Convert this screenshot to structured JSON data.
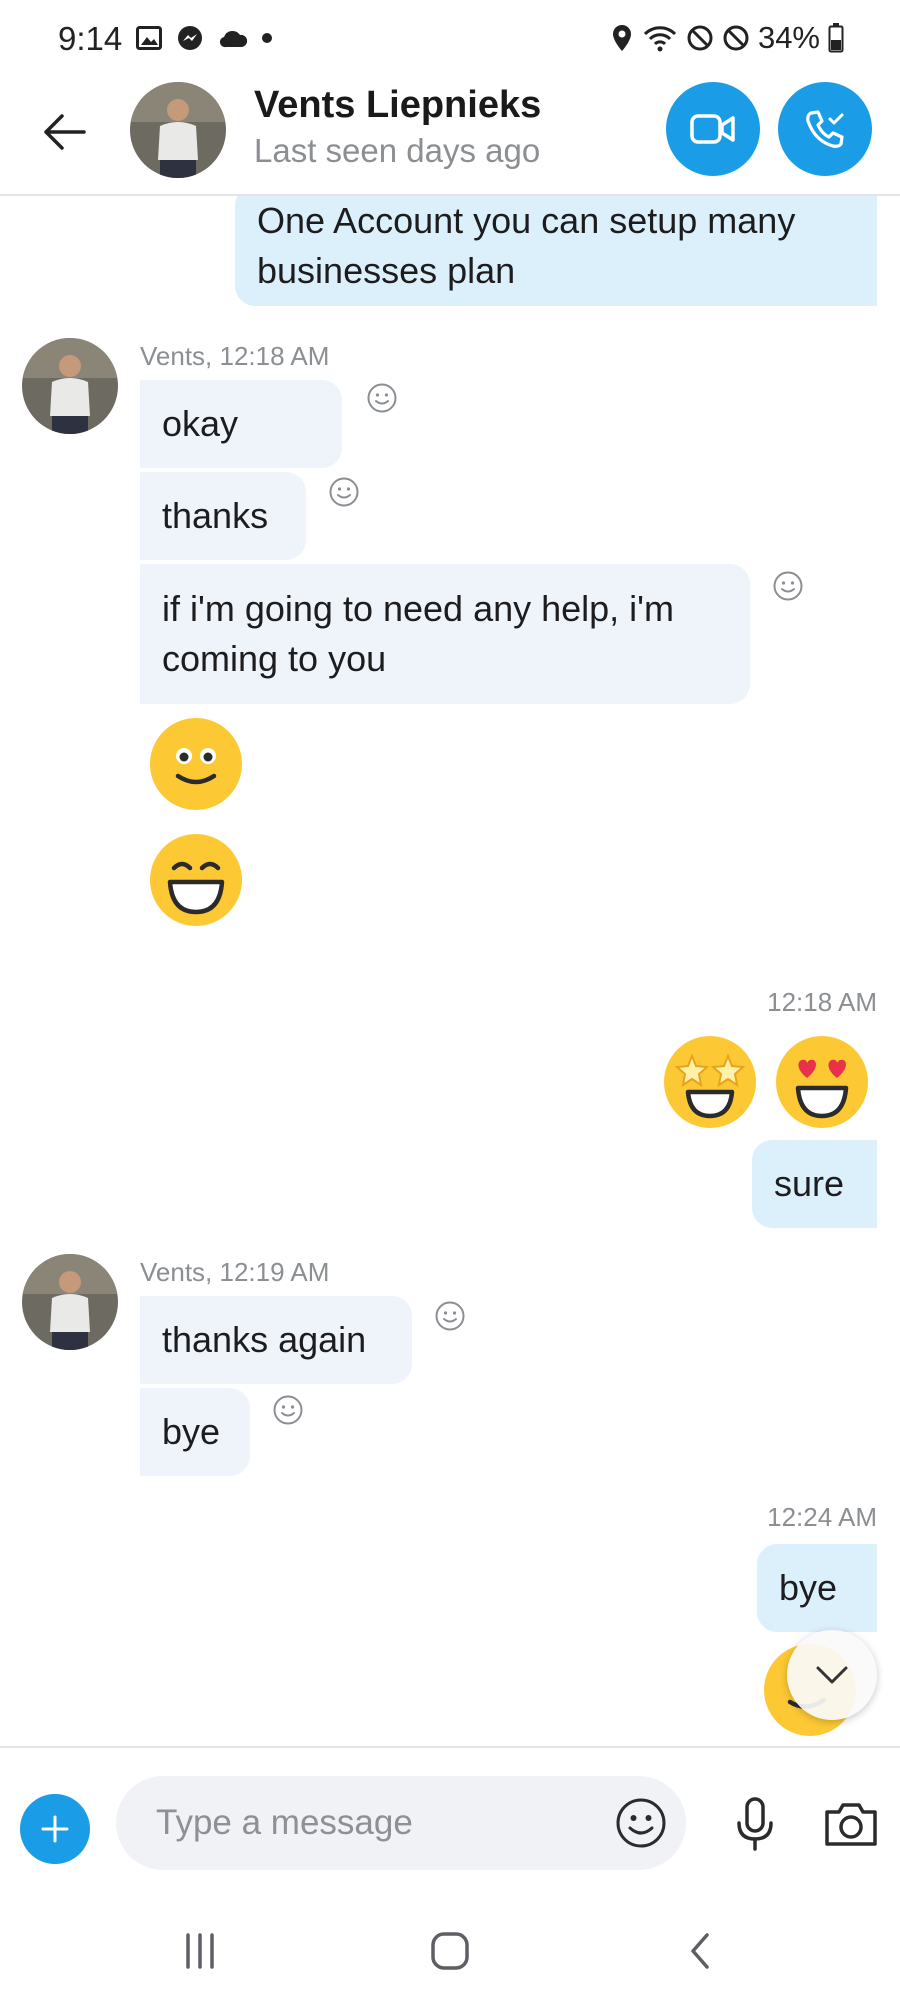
{
  "status_bar": {
    "time": "9:14",
    "battery": "34%"
  },
  "header": {
    "back_icon": "arrow-left-icon",
    "contact_name": "Vents Liepnieks",
    "contact_status": "Last seen days ago",
    "video_icon": "video-camera-icon",
    "call_icon": "phone-icon"
  },
  "messages": {
    "top_out": {
      "line1": "One Account you can setup many",
      "line2": "businesses plan"
    },
    "group1": {
      "meta": "Vents, 12:18 AM",
      "msg1": "okay",
      "msg2": "thanks",
      "msg3_line1": "if i'm going to need any help, i'm",
      "msg3_line2": "coming to you",
      "emojis": [
        "smile-emoji",
        "laugh-emoji"
      ]
    },
    "group2": {
      "meta": "12:18 AM",
      "emojis": [
        "star-struck-emoji",
        "heart-eyes-emoji"
      ],
      "msg1": "sure"
    },
    "group3": {
      "meta": "Vents, 12:19 AM",
      "msg1": "thanks again",
      "msg2": "bye"
    },
    "group4": {
      "meta": "12:24 AM",
      "msg1": "bye",
      "emojis": [
        "wink-emoji"
      ]
    }
  },
  "composer": {
    "placeholder": "Type a message"
  },
  "colors": {
    "accent": "#1a9ce6",
    "incoming": "#eef4f9",
    "outgoing": "#dcf0fc",
    "emoji_yellow": "#fcc934"
  }
}
